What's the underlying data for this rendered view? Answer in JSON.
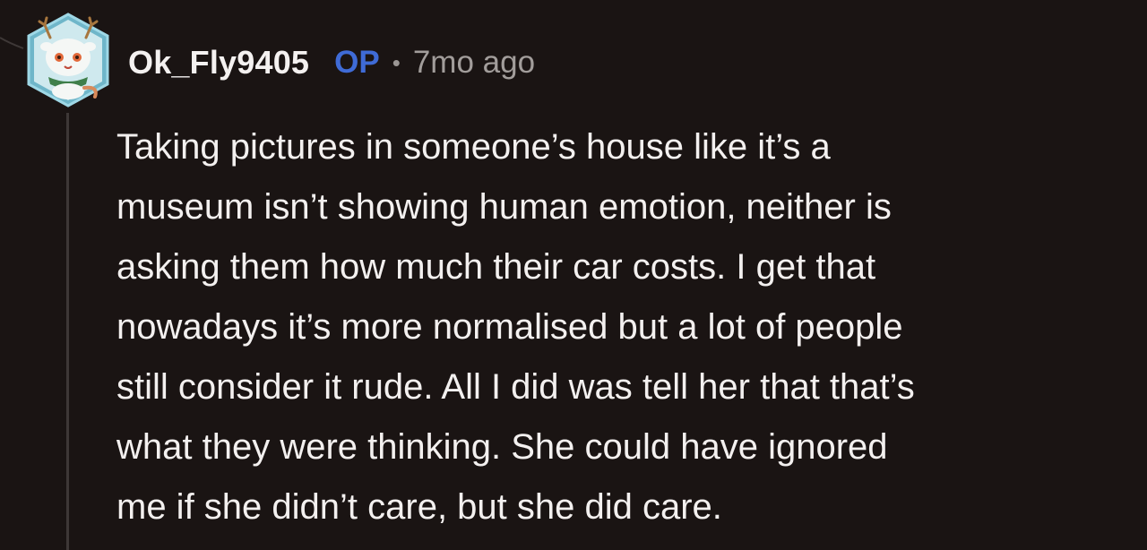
{
  "comment": {
    "author": "Ok_Fly9405",
    "badge": "OP",
    "separator": "•",
    "time": "7mo ago",
    "body": "Taking pictures in someone’s house like it’s a\nmuseum isn’t showing human emotion, neither is\nasking them how much their car costs. I get that\nnowadays it’s more normalised but a lot of people\nstill consider it rude. All I did was tell her that that’s\nwhat they were thinking. She could have ignored\nme if she didn’t care, but she did care."
  },
  "colors": {
    "background": "#1a1413",
    "text": "#f3f0ef",
    "op_badge": "#3f6bd6",
    "meta": "#a29d9b",
    "thread_line": "#3e3837"
  },
  "icons": {
    "avatar": "snoo-avatar-with-antlers"
  }
}
